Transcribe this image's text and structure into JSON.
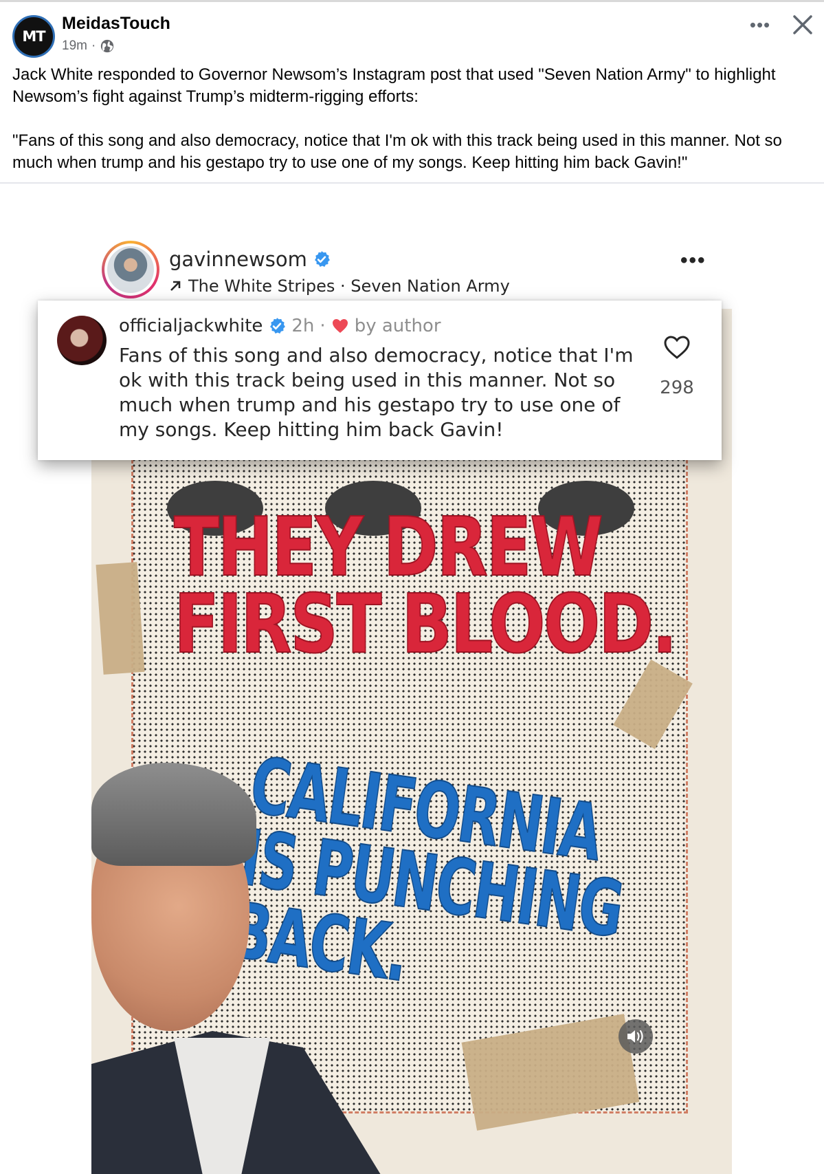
{
  "post": {
    "page_name": "MeidasTouch",
    "avatar_text": "MT",
    "time": "19m",
    "meta_separator": "·",
    "visibility_icon": "globe-icon",
    "paragraph_1": "Jack White responded to Governor Newsom’s Instagram post that used \"Seven Nation Army\" to highlight Newsom’s fight against Trump’s midterm-rigging efforts:",
    "paragraph_2": "\"Fans of this song and also democracy, notice that I'm ok with this track being used in this manner. Not so much when trump and his gestapo try to use one of my songs. Keep hitting him back Gavin!\""
  },
  "instagram": {
    "username": "gavinnewsom",
    "song": "The White Stripes · Seven Nation Army",
    "song_icon": "arrow-up-right-icon",
    "more_label": "•••"
  },
  "comment": {
    "username": "officialjackwhite",
    "time": "2h",
    "separator": "·",
    "liked_label": "by author",
    "body": "Fans of this song and also democracy, notice that I'm ok with this track being used in this manner. Not so much when trump and his gestapo try to use one of my songs.  Keep hitting him back Gavin!",
    "like_count": "298"
  },
  "poster": {
    "headline_red_line1": "THEY DREW",
    "headline_red_line2": "FIRST BLOOD.",
    "headline_blue_line1": "CALIFORNIA",
    "headline_blue_line2": "IS PUNCHING",
    "headline_blue_line3": "BACK."
  },
  "colors": {
    "facebook_text": "#050505",
    "verified_blue": "#3897f0",
    "heart_red": "#ed4956",
    "headline_red": "#d9263a",
    "headline_blue": "#1f6fc4"
  }
}
